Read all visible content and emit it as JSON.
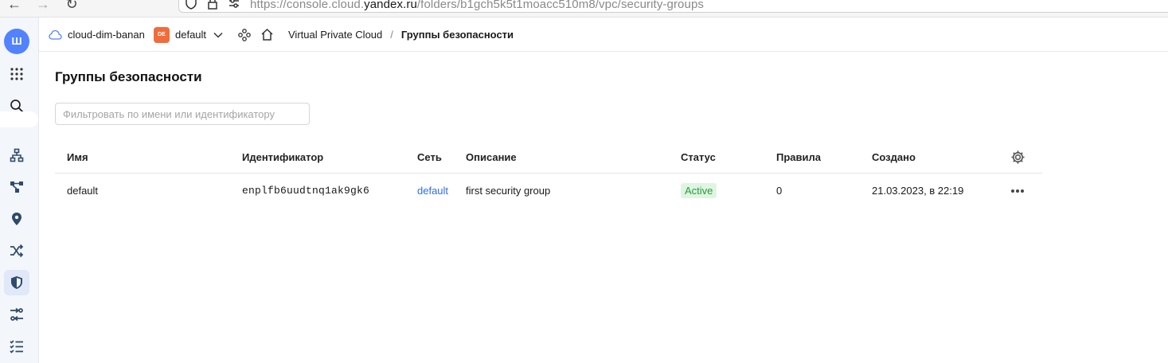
{
  "browser": {
    "url_prefix": "https://console.cloud.",
    "url_host": "yandex.ru",
    "url_path": "/folders/b1gch5k5t1moacc510m8/vpc/security-groups"
  },
  "rail": {
    "logo_label": "Ш",
    "items": [
      {
        "icon": "apps-grid-icon"
      },
      {
        "icon": "search-icon"
      },
      {
        "icon": "network-icon"
      },
      {
        "icon": "topology-icon"
      },
      {
        "icon": "location-pin-icon"
      },
      {
        "icon": "shuffle-icon"
      },
      {
        "icon": "shield-icon",
        "active": true
      },
      {
        "icon": "routes-icon"
      },
      {
        "icon": "checklist-icon"
      }
    ]
  },
  "header": {
    "cloud_name": "cloud-dim-banan",
    "folder_badge": "DE",
    "folder_name": "default",
    "breadcrumb": {
      "service": "Virtual Private Cloud",
      "separator": "/",
      "current": "Группы безопасности"
    }
  },
  "page": {
    "title": "Группы безопасности",
    "filter_placeholder": "Фильтровать по имени или идентификатору",
    "filter_value": ""
  },
  "table": {
    "columns": {
      "name": "Имя",
      "id": "Идентификатор",
      "network": "Сеть",
      "description": "Описание",
      "status": "Статус",
      "rules": "Правила",
      "created": "Создано"
    },
    "rows": [
      {
        "name": "default",
        "id": "enplfb6uudtnq1ak9gk6",
        "network": "default",
        "description": "first security group",
        "status": "Active",
        "rules": "0",
        "created": "21.03.2023, в 22:19"
      }
    ]
  },
  "colors": {
    "accent": "#5282ff",
    "link": "#2f6ee0",
    "status_active_bg": "#dff5e2",
    "status_active_text": "#2a9a3c",
    "folder_badge": "#f26b3a"
  }
}
